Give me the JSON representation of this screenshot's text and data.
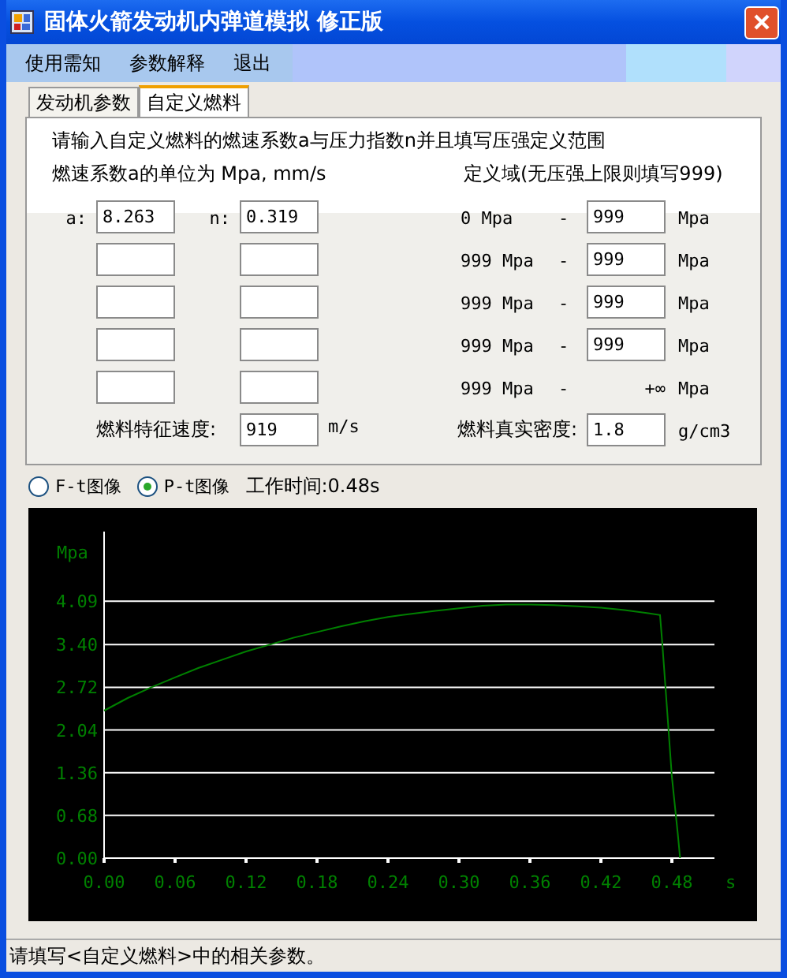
{
  "window": {
    "title": "固体火箭发动机内弹道模拟  修正版"
  },
  "menu": [
    "使用需知",
    "参数解释",
    "退出"
  ],
  "tabs": [
    {
      "label": "发动机参数",
      "selected": false
    },
    {
      "label": "自定义燃料",
      "selected": true
    }
  ],
  "instructions": [
    "请输入自定义燃料的燃速系数a与压力指数n并且填写压强定义范围",
    "燃速系数a的单位为 Mpa, mm/s"
  ],
  "domain_heading": "定义域(无压强上限则填写999)",
  "rows": [
    {
      "kind": "field",
      "a_label": "a:",
      "a": "8.263",
      "n_label": "n:",
      "n": "0.319",
      "lower": "0 Mpa",
      "dash": "-",
      "upper": "999",
      "unit": "Mpa"
    },
    {
      "kind": "field",
      "lower": "999 Mpa",
      "dash": "-",
      "upper": "999",
      "unit": "Mpa"
    },
    {
      "kind": "field",
      "lower": "999 Mpa",
      "dash": "-",
      "upper": "999",
      "unit": "Mpa"
    },
    {
      "kind": "field",
      "lower": "999 Mpa",
      "dash": "-",
      "upper": "999",
      "unit": "Mpa"
    },
    {
      "kind": "fixed",
      "lower": "999 Mpa",
      "dash": "-",
      "upper": "+∞",
      "unit": "Mpa"
    }
  ],
  "speed": {
    "label": "燃料特征速度:",
    "value": "919",
    "unit": "m/s"
  },
  "density": {
    "label": "燃料真实密度:",
    "value": "1.8",
    "unit": "g/cm3"
  },
  "plot_options": [
    {
      "label": "F-t图像",
      "selected": false
    },
    {
      "label": "P-t图像",
      "selected": true
    }
  ],
  "work_time": "工作时间:0.48s",
  "chart": {
    "chart_data": {
      "type": "line",
      "ylabel": "Mpa",
      "xlabel": "s",
      "xlim": [
        0,
        0.516
      ],
      "ylim": [
        0,
        5.2
      ],
      "x": [
        0,
        0.02,
        0.04,
        0.06,
        0.08,
        0.1,
        0.12,
        0.14,
        0.16,
        0.18,
        0.2,
        0.22,
        0.24,
        0.26,
        0.28,
        0.3,
        0.32,
        0.34,
        0.36,
        0.38,
        0.4,
        0.42,
        0.44,
        0.46,
        0.47,
        0.472,
        0.475,
        0.48,
        0.485,
        0.487
      ],
      "grid": true,
      "series": [
        {
          "color": "#008000",
          "values": [
            2.35,
            2.55,
            2.72,
            2.88,
            3.03,
            3.16,
            3.29,
            3.4,
            3.51,
            3.6,
            3.69,
            3.77,
            3.84,
            3.89,
            3.94,
            3.98,
            4.02,
            4.04,
            4.04,
            4.03,
            4.01,
            3.99,
            3.95,
            3.9,
            3.87,
            3.4,
            2.6,
            1.3,
            0.4,
            0
          ]
        }
      ],
      "xticks": [
        {
          "value": 0,
          "label": "0.00"
        },
        {
          "value": 0.06,
          "label": "0.06"
        },
        {
          "value": 0.12,
          "label": "0.12"
        },
        {
          "value": 0.18,
          "label": "0.18"
        },
        {
          "value": 0.24,
          "label": "0.24"
        },
        {
          "value": 0.3,
          "label": "0.30"
        },
        {
          "value": 0.36,
          "label": "0.36"
        },
        {
          "value": 0.42,
          "label": "0.42"
        },
        {
          "value": 0.48,
          "label": "0.48"
        }
      ],
      "yticks": [
        {
          "value": 0,
          "label": "0.00"
        },
        {
          "value": 0.68,
          "label": "0.68"
        },
        {
          "value": 1.36,
          "label": "1.36"
        },
        {
          "value": 2.04,
          "label": "2.04"
        },
        {
          "value": 2.72,
          "label": "2.72"
        },
        {
          "value": 3.4,
          "label": "3.40"
        },
        {
          "value": 4.09,
          "label": "4.09"
        }
      ]
    }
  },
  "status_bar": "请填写<自定义燃料>中的相关参数。"
}
